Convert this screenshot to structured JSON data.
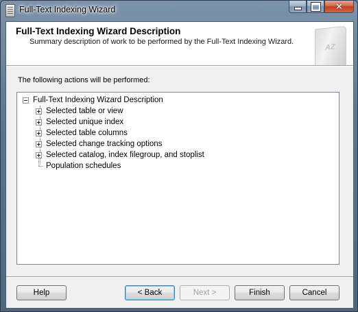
{
  "window": {
    "title": "Full-Text Indexing Wizard"
  },
  "header": {
    "title": "Full-Text Indexing Wizard Description",
    "subtitle": "Summary description of work to be performed by the Full-Text Indexing Wizard."
  },
  "actions_label": "The following actions will be performed:",
  "tree": {
    "root": "Full-Text Indexing Wizard Description",
    "items": [
      {
        "label": "Selected table or view",
        "expandable": true
      },
      {
        "label": "Selected unique index",
        "expandable": true
      },
      {
        "label": "Selected table columns",
        "expandable": true
      },
      {
        "label": "Selected change tracking options",
        "expandable": true
      },
      {
        "label": "Selected catalog, index filegroup, and stoplist",
        "expandable": true
      },
      {
        "label": "Population schedules",
        "expandable": false
      }
    ]
  },
  "buttons": {
    "help": "Help",
    "back": "< Back",
    "next": "Next >",
    "finish": "Finish",
    "cancel": "Cancel"
  },
  "icons": {
    "app": "wizard-document-icon",
    "header_graphic": "book-az-icon"
  }
}
